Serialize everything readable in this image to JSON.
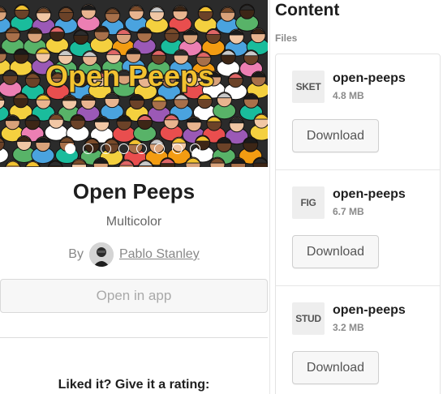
{
  "hero": {
    "banner_text": "Open Peeps",
    "slide_count": 8,
    "active_slide": 1
  },
  "product": {
    "title": "Open Peeps",
    "subtitle": "Multicolor",
    "by_label": "By",
    "author": "Pablo Stanley",
    "open_app_label": "Open in app"
  },
  "rating": {
    "title": "Liked it? Give it a rating:"
  },
  "sidebar": {
    "title": "Content",
    "files_label": "Files",
    "files": [
      {
        "type": "SKET",
        "name": "open-peeps",
        "size": "4.8 MB",
        "button": "Download"
      },
      {
        "type": "FIG",
        "name": "open-peeps",
        "size": "6.7 MB",
        "button": "Download"
      },
      {
        "type": "STUD",
        "name": "open-peeps",
        "size": "3.2 MB",
        "button": "Download"
      }
    ]
  },
  "colors": {
    "banner_text": "#f2c230",
    "banner_outline": "#1a1a1a",
    "button_bg": "#f7f7f7",
    "border": "#d9d9d9"
  }
}
